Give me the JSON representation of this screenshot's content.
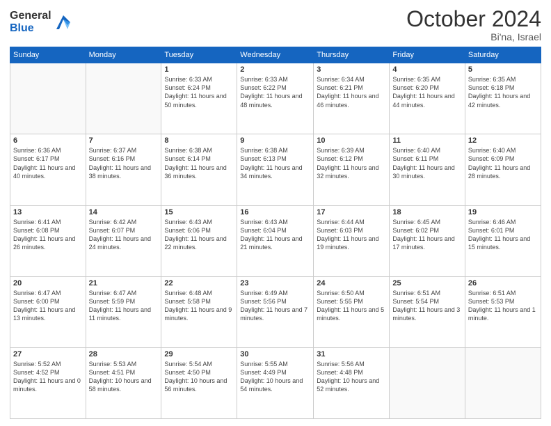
{
  "logo": {
    "general": "General",
    "blue": "Blue"
  },
  "header": {
    "month": "October 2024",
    "location": "Bi'na, Israel"
  },
  "weekdays": [
    "Sunday",
    "Monday",
    "Tuesday",
    "Wednesday",
    "Thursday",
    "Friday",
    "Saturday"
  ],
  "weeks": [
    [
      {
        "day": "",
        "info": ""
      },
      {
        "day": "",
        "info": ""
      },
      {
        "day": "1",
        "info": "Sunrise: 6:33 AM\nSunset: 6:24 PM\nDaylight: 11 hours and 50 minutes."
      },
      {
        "day": "2",
        "info": "Sunrise: 6:33 AM\nSunset: 6:22 PM\nDaylight: 11 hours and 48 minutes."
      },
      {
        "day": "3",
        "info": "Sunrise: 6:34 AM\nSunset: 6:21 PM\nDaylight: 11 hours and 46 minutes."
      },
      {
        "day": "4",
        "info": "Sunrise: 6:35 AM\nSunset: 6:20 PM\nDaylight: 11 hours and 44 minutes."
      },
      {
        "day": "5",
        "info": "Sunrise: 6:35 AM\nSunset: 6:18 PM\nDaylight: 11 hours and 42 minutes."
      }
    ],
    [
      {
        "day": "6",
        "info": "Sunrise: 6:36 AM\nSunset: 6:17 PM\nDaylight: 11 hours and 40 minutes."
      },
      {
        "day": "7",
        "info": "Sunrise: 6:37 AM\nSunset: 6:16 PM\nDaylight: 11 hours and 38 minutes."
      },
      {
        "day": "8",
        "info": "Sunrise: 6:38 AM\nSunset: 6:14 PM\nDaylight: 11 hours and 36 minutes."
      },
      {
        "day": "9",
        "info": "Sunrise: 6:38 AM\nSunset: 6:13 PM\nDaylight: 11 hours and 34 minutes."
      },
      {
        "day": "10",
        "info": "Sunrise: 6:39 AM\nSunset: 6:12 PM\nDaylight: 11 hours and 32 minutes."
      },
      {
        "day": "11",
        "info": "Sunrise: 6:40 AM\nSunset: 6:11 PM\nDaylight: 11 hours and 30 minutes."
      },
      {
        "day": "12",
        "info": "Sunrise: 6:40 AM\nSunset: 6:09 PM\nDaylight: 11 hours and 28 minutes."
      }
    ],
    [
      {
        "day": "13",
        "info": "Sunrise: 6:41 AM\nSunset: 6:08 PM\nDaylight: 11 hours and 26 minutes."
      },
      {
        "day": "14",
        "info": "Sunrise: 6:42 AM\nSunset: 6:07 PM\nDaylight: 11 hours and 24 minutes."
      },
      {
        "day": "15",
        "info": "Sunrise: 6:43 AM\nSunset: 6:06 PM\nDaylight: 11 hours and 22 minutes."
      },
      {
        "day": "16",
        "info": "Sunrise: 6:43 AM\nSunset: 6:04 PM\nDaylight: 11 hours and 21 minutes."
      },
      {
        "day": "17",
        "info": "Sunrise: 6:44 AM\nSunset: 6:03 PM\nDaylight: 11 hours and 19 minutes."
      },
      {
        "day": "18",
        "info": "Sunrise: 6:45 AM\nSunset: 6:02 PM\nDaylight: 11 hours and 17 minutes."
      },
      {
        "day": "19",
        "info": "Sunrise: 6:46 AM\nSunset: 6:01 PM\nDaylight: 11 hours and 15 minutes."
      }
    ],
    [
      {
        "day": "20",
        "info": "Sunrise: 6:47 AM\nSunset: 6:00 PM\nDaylight: 11 hours and 13 minutes."
      },
      {
        "day": "21",
        "info": "Sunrise: 6:47 AM\nSunset: 5:59 PM\nDaylight: 11 hours and 11 minutes."
      },
      {
        "day": "22",
        "info": "Sunrise: 6:48 AM\nSunset: 5:58 PM\nDaylight: 11 hours and 9 minutes."
      },
      {
        "day": "23",
        "info": "Sunrise: 6:49 AM\nSunset: 5:56 PM\nDaylight: 11 hours and 7 minutes."
      },
      {
        "day": "24",
        "info": "Sunrise: 6:50 AM\nSunset: 5:55 PM\nDaylight: 11 hours and 5 minutes."
      },
      {
        "day": "25",
        "info": "Sunrise: 6:51 AM\nSunset: 5:54 PM\nDaylight: 11 hours and 3 minutes."
      },
      {
        "day": "26",
        "info": "Sunrise: 6:51 AM\nSunset: 5:53 PM\nDaylight: 11 hours and 1 minute."
      }
    ],
    [
      {
        "day": "27",
        "info": "Sunrise: 5:52 AM\nSunset: 4:52 PM\nDaylight: 11 hours and 0 minutes."
      },
      {
        "day": "28",
        "info": "Sunrise: 5:53 AM\nSunset: 4:51 PM\nDaylight: 10 hours and 58 minutes."
      },
      {
        "day": "29",
        "info": "Sunrise: 5:54 AM\nSunset: 4:50 PM\nDaylight: 10 hours and 56 minutes."
      },
      {
        "day": "30",
        "info": "Sunrise: 5:55 AM\nSunset: 4:49 PM\nDaylight: 10 hours and 54 minutes."
      },
      {
        "day": "31",
        "info": "Sunrise: 5:56 AM\nSunset: 4:48 PM\nDaylight: 10 hours and 52 minutes."
      },
      {
        "day": "",
        "info": ""
      },
      {
        "day": "",
        "info": ""
      }
    ]
  ]
}
